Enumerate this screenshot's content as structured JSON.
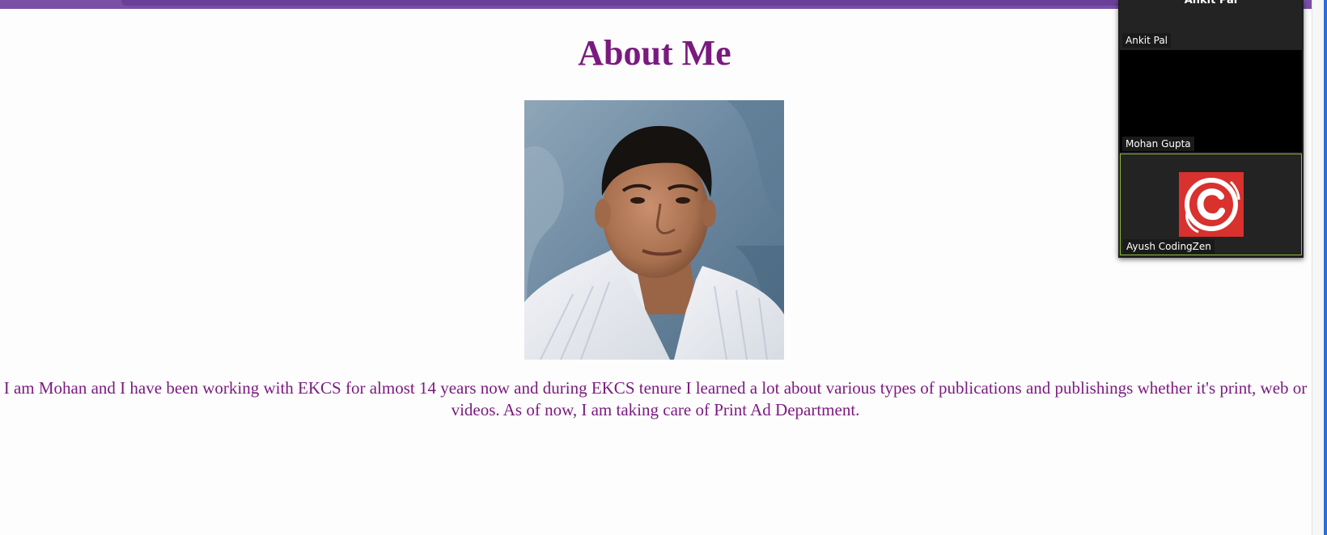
{
  "page": {
    "title": "About Me",
    "bio": "I am Mohan and I have been working with EKCS for almost 14 years now and during EKCS tenure I learned a lot about various types of publications and publishings whether it's print, web or videos. As of now, I am taking care of Print Ad Department.",
    "accent_color": "#7a1a7f",
    "band_color": "#7a4fa6"
  },
  "meeting": {
    "participants": [
      {
        "name": "Ankit Pal",
        "video": "off",
        "top_caption": "Ankit Pal"
      },
      {
        "name": "Mohan Gupta",
        "video": "black"
      },
      {
        "name": "Ayush CodingZen",
        "video": "avatar",
        "avatar_icon": "copyright-c-logo-icon",
        "avatar_color": "#d8312e",
        "active_speaker": true
      }
    ],
    "active_border_color": "#8fb93a"
  }
}
